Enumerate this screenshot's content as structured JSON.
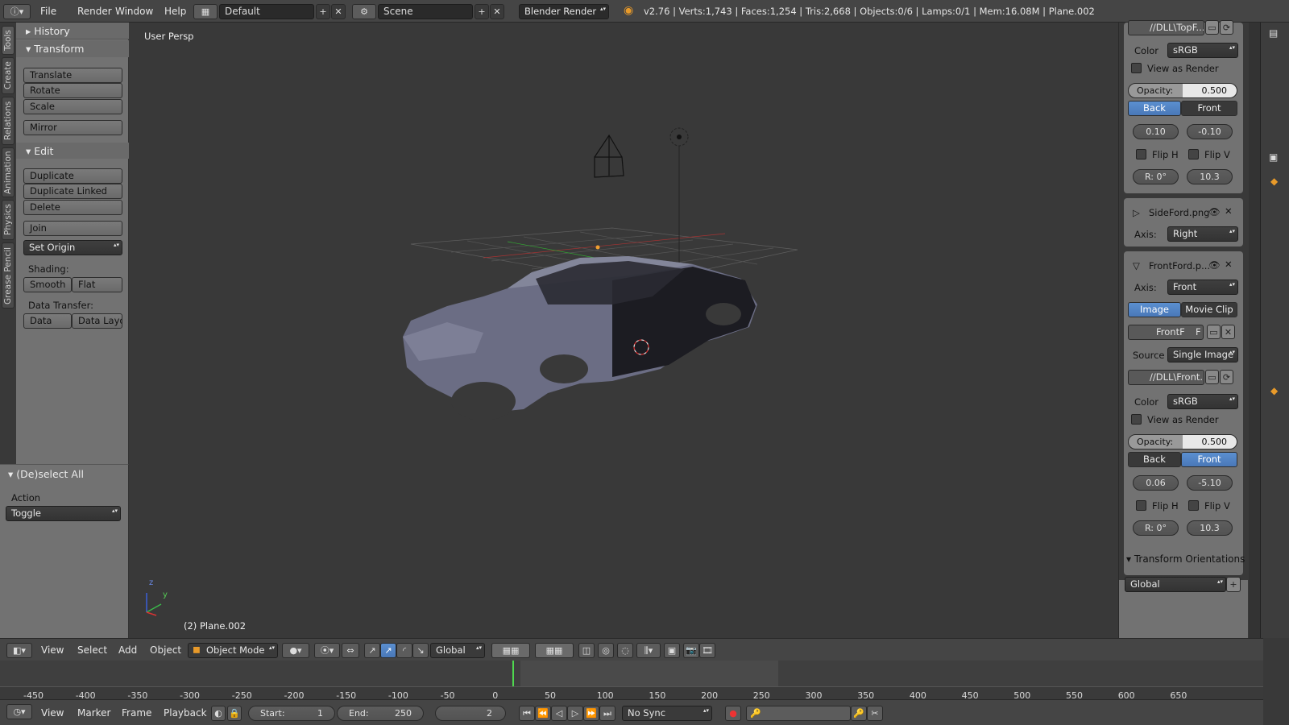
{
  "topbar": {
    "menus": [
      "File",
      "Render",
      "Window",
      "Help"
    ],
    "layout": "Default",
    "scene": "Scene",
    "engine": "Blender Render",
    "stats": "v2.76 | Verts:1,743 | Faces:1,254 | Tris:2,668 | Objects:0/6 | Lamps:0/1 | Mem:16.08M | Plane.002"
  },
  "sidetabs": [
    "Tools",
    "Create",
    "Relations",
    "Animation",
    "Physics",
    "Grease Pencil"
  ],
  "toolshelf": {
    "history": "History",
    "transform": "Transform",
    "translate": "Translate",
    "rotate": "Rotate",
    "scale": "Scale",
    "mirror": "Mirror",
    "edit": "Edit",
    "duplicate": "Duplicate",
    "duplicate_linked": "Duplicate Linked",
    "delete": "Delete",
    "join": "Join",
    "set_origin": "Set Origin",
    "shading": "Shading:",
    "smooth": "Smooth",
    "flat": "Flat",
    "data_transfer": "Data Transfer:",
    "data": "Data",
    "data_layo": "Data Layo"
  },
  "operator": {
    "title": "(De)select All",
    "action_label": "Action",
    "action_value": "Toggle"
  },
  "viewport": {
    "view_name": "User Persp",
    "object_name": "(2) Plane.002",
    "axis_z": "z",
    "axis_y": "y"
  },
  "props": {
    "top_path": "//DLL\\TopF...",
    "color_label": "Color",
    "color_value": "sRGB",
    "view_as_render": "View as Render",
    "opacity_label": "Opacity:",
    "opacity_value": "0.500",
    "back": "Back",
    "front": "Front",
    "off_x": "0.10",
    "off_y": "-0.10",
    "flip_h": "Flip H",
    "flip_v": "Flip V",
    "rot": "R: 0°",
    "size": "10.3",
    "side_name": "SideFord.png",
    "axis_label": "Axis:",
    "side_axis": "Right",
    "front_name": "FrontFord.p...",
    "front_axis": "Front",
    "image": "Image",
    "movie_clip": "Movie Clip",
    "front_img": "FrontF",
    "front_f": "F",
    "source_label": "Source",
    "source_value": "Single Image",
    "front_path": "//DLL\\Front...",
    "color2": "sRGB",
    "opacity2": "0.500",
    "off2_x": "0.06",
    "off2_y": "-5.10",
    "rot2": "R: 0°",
    "size2": "10.3",
    "transform_orient": "Transform Orientations",
    "orient_value": "Global"
  },
  "viewheader": {
    "view": "View",
    "select": "Select",
    "add": "Add",
    "object": "Object",
    "mode": "Object Mode",
    "orient": "Global"
  },
  "timeline": {
    "ticks": [
      "-450",
      "-400",
      "-350",
      "-300",
      "-250",
      "-200",
      "-150",
      "-100",
      "-50",
      "0",
      "50",
      "100",
      "150",
      "200",
      "250",
      "300",
      "350",
      "400",
      "450",
      "500",
      "550",
      "600",
      "650"
    ],
    "view": "View",
    "marker": "Marker",
    "frame": "Frame",
    "playback": "Playback",
    "start": "Start:",
    "start_val": "1",
    "end": "End:",
    "end_val": "250",
    "current": "2",
    "sync": "No Sync"
  },
  "colors": {
    "accent": "#5680c2",
    "bg": "#393939",
    "panel": "#727272"
  }
}
